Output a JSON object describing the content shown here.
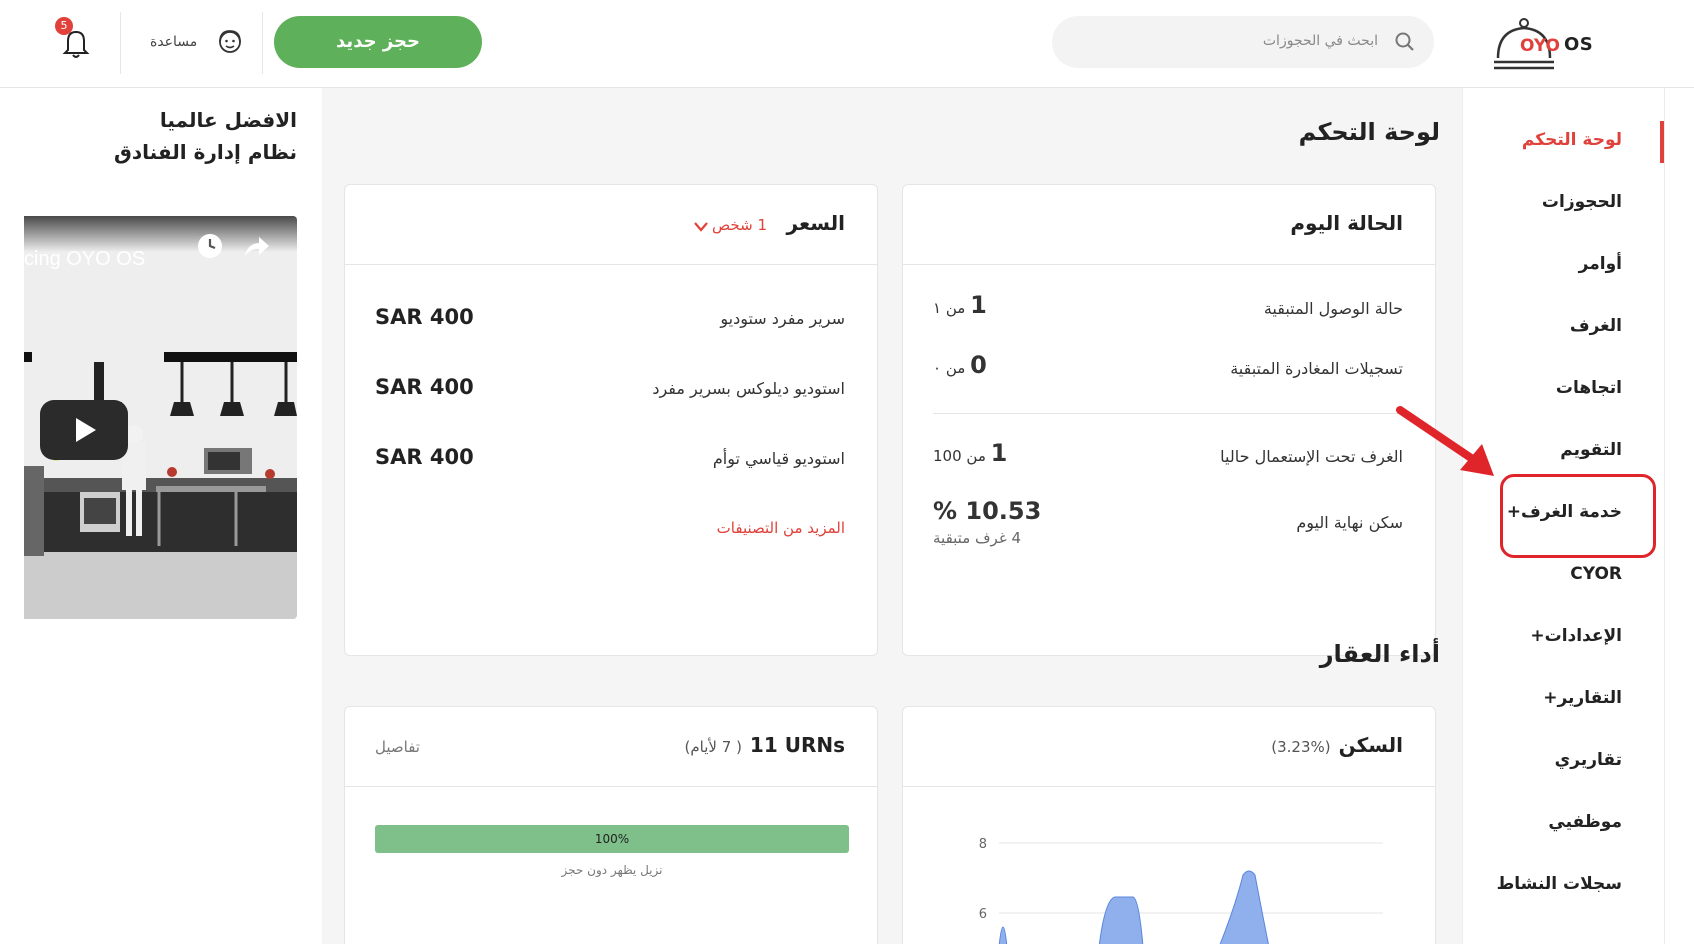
{
  "header": {
    "logo_text": "OYO",
    "logo_os": "OS",
    "search_placeholder": "ابحث في الحجوزات",
    "new_booking_label": "حجز جديد",
    "help_label": "مساعدة",
    "notifications_count": "5"
  },
  "sidebar": {
    "items": [
      {
        "label": "لوحة التحكم",
        "active": true
      },
      {
        "label": "الحجوزات"
      },
      {
        "label": "أوامر"
      },
      {
        "label": "الغرف"
      },
      {
        "label": "اتجاهات"
      },
      {
        "label": "التقويم"
      },
      {
        "label": "خدمة الغرف+"
      },
      {
        "label": "CYOR"
      },
      {
        "label": "الإعدادات+"
      },
      {
        "label": "التقارير+"
      },
      {
        "label": "تقاريري"
      },
      {
        "label": "موظفيي"
      },
      {
        "label": "سجلات النشاط"
      }
    ]
  },
  "main": {
    "dashboard_title": "لوحة التحكم",
    "performance_title": "أداء العقار",
    "status_card": {
      "title": "الحالة اليوم",
      "rows": [
        {
          "label": "حالة الوصول المتبقية",
          "value": "1",
          "suffix": "من ١"
        },
        {
          "label": "تسجيلات المغادرة المتبقية",
          "value": "0",
          "suffix": "من ٠"
        },
        {
          "label": "الغرف تحت الإستعمال حاليا",
          "value": "1",
          "suffix": "من 100"
        },
        {
          "label": "سكن نهاية اليوم",
          "value": "% 10.53",
          "sub": "4 غرف متبقية"
        }
      ]
    },
    "price_card": {
      "title": "السعر",
      "selector": "1 شخص",
      "rows": [
        {
          "label": "سرير مفرد ستوديو",
          "price": "SAR 400"
        },
        {
          "label": "استوديو ديلوكس بسرير مفرد",
          "price": "SAR 400"
        },
        {
          "label": "استوديو قياسي توأم",
          "price": "SAR 400"
        }
      ],
      "more_link": "المزيد من التصنيفات"
    },
    "occupancy_card": {
      "title": "السكن",
      "pct": "(3.23%)"
    },
    "urn_card": {
      "title": "11 URNs",
      "period": "( 7 لأيام)",
      "details_link": "تفاصيل",
      "bar_label": "100%",
      "bar_caption": "نزيل يظهر دون حجز"
    }
  },
  "promo": {
    "line1": "الافضل عالميا",
    "line2": "نظام إدارة الفنادق",
    "video_title": "cing OYO OS"
  },
  "chart_data": {
    "type": "area",
    "title": "السكن",
    "y_ticks": [
      8,
      6
    ],
    "colors": {
      "fill": "#8fb0ec",
      "stroke": "#5b86dd"
    }
  },
  "colors": {
    "accent_red": "#e0413a",
    "primary_green": "#5fb05a",
    "progress_green": "#7fc08a"
  }
}
